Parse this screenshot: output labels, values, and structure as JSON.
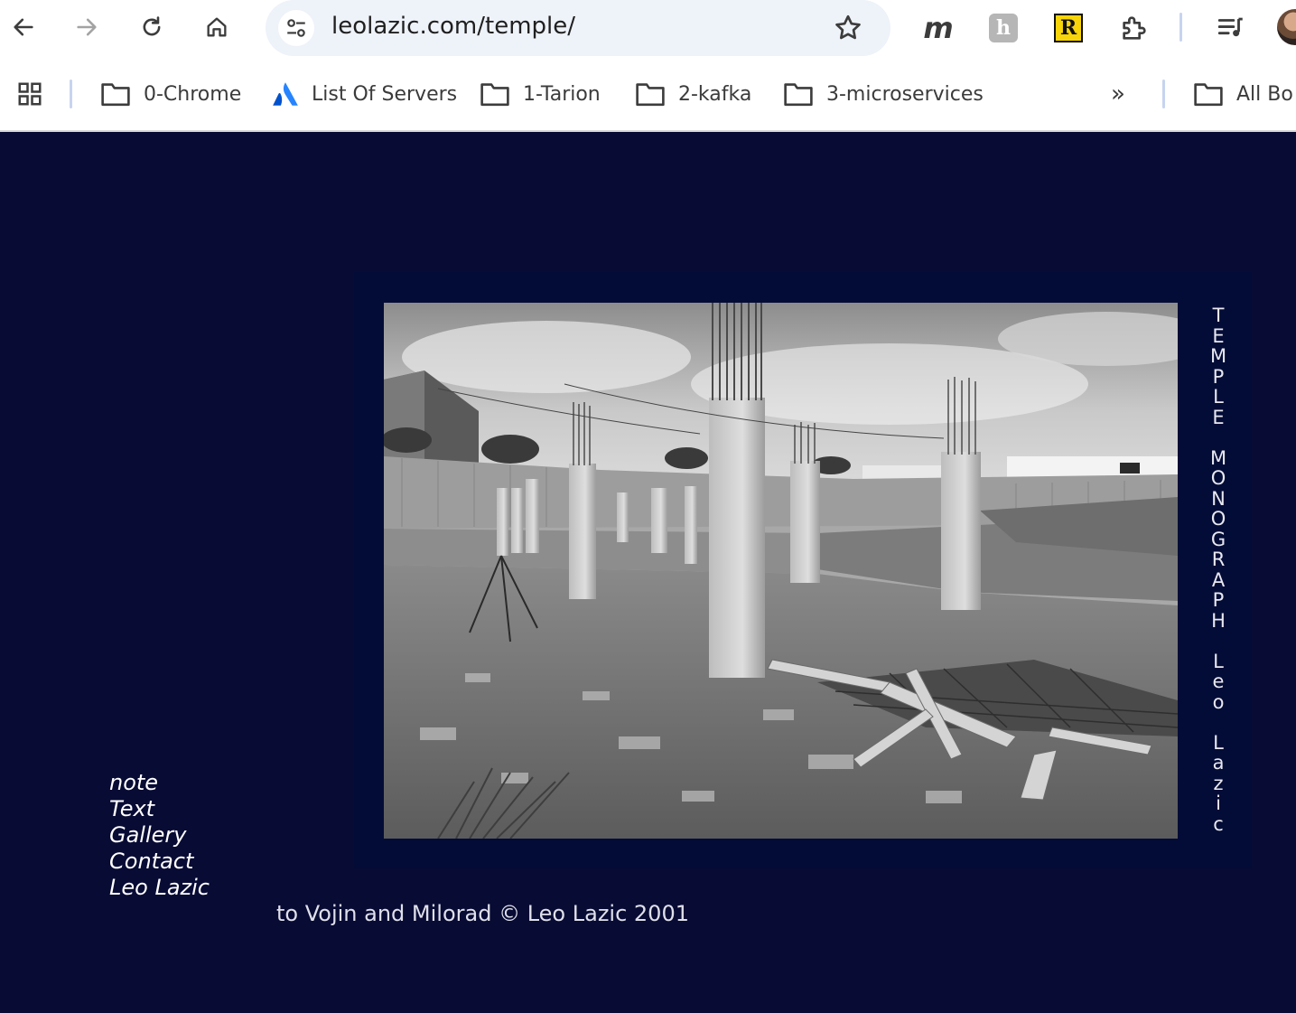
{
  "browser": {
    "url": "leolazic.com/temple/",
    "extensions": {
      "m": "m",
      "h": "h",
      "r": "R"
    },
    "bookmarks": [
      {
        "label": "0-Chrome",
        "icon": "folder-icon"
      },
      {
        "label": "List Of Servers",
        "icon": "atlassian-icon"
      },
      {
        "label": "1-Tarion",
        "icon": "folder-icon"
      },
      {
        "label": "2-kafka",
        "icon": "folder-icon"
      },
      {
        "label": "3-microservices",
        "icon": "folder-icon"
      }
    ],
    "overflow_label": "»",
    "all_bookmarks_label": "All Bo",
    "colors": {
      "omnibox_bg": "#eef2f9",
      "separator": "#c7d4ef"
    }
  },
  "page": {
    "title_vertical": "TEMPLE MONOGRAPH Leo Lazic",
    "nav": [
      "note",
      "Text",
      "Gallery",
      "Contact",
      "Leo Lazic"
    ],
    "dedication": "to Vojin and Milorad © Leo Lazic 2001",
    "colors": {
      "background": "#080b34",
      "frame": "#030c36"
    }
  }
}
